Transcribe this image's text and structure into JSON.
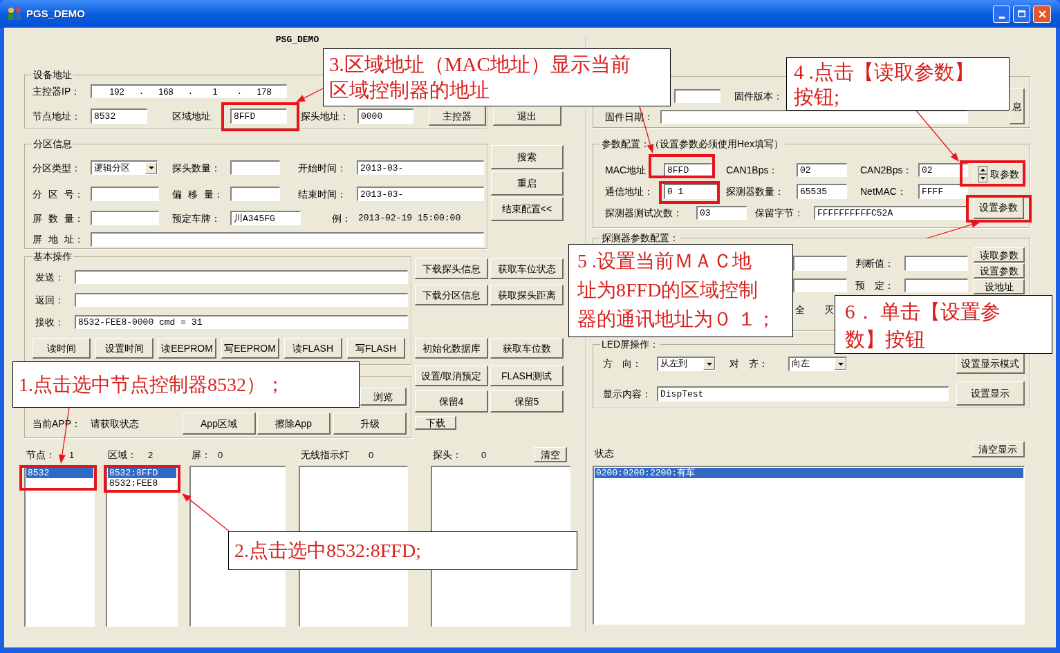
{
  "window": {
    "title": "PGS_DEMO",
    "heading": "PSG_DEMO"
  },
  "device_address": {
    "title": "设备地址",
    "ip": {
      "label": "主控器IP：",
      "octets": [
        "192",
        "168",
        "1",
        "178"
      ],
      "separators": [
        ".",
        ".",
        "."
      ]
    },
    "fields": [
      {
        "label": "节点地址：",
        "value": "8532"
      },
      {
        "label": "区域地址",
        "value": "8FFD"
      },
      {
        "label": "探头地址：",
        "value": "0000"
      }
    ],
    "buttons": [
      "主控器",
      "退出"
    ]
  },
  "partition_info": {
    "title": "分区信息",
    "rows": [
      [
        {
          "kind": "combo",
          "label": "分区类型：",
          "value": "逻辑分区"
        },
        {
          "kind": "field",
          "label": "探头数量："
        },
        {
          "kind": "field",
          "label": "开始时间：",
          "value": "2013-03-"
        }
      ],
      [
        {
          "kind": "field",
          "label": "分 区 号："
        },
        {
          "kind": "field",
          "label": "偏 移 量："
        },
        {
          "kind": "field",
          "label": "结束时间：",
          "value": "2013-03-"
        }
      ],
      [
        {
          "kind": "field",
          "label": "屏 数 量："
        },
        {
          "kind": "field",
          "label": "预定车牌：",
          "value": "川A345FG"
        },
        {
          "kind": "text",
          "label": "例：",
          "value": "2013-02-19 15:00:00"
        }
      ],
      [
        {
          "kind": "field",
          "label": "屏 地 址："
        }
      ]
    ],
    "buttons": [
      "搜索",
      "重启",
      "结束配置<<"
    ]
  },
  "basic_operations": {
    "title": "基本操作",
    "fields": [
      {
        "label": "发送："
      },
      {
        "label": "返回："
      },
      {
        "label": "接收：",
        "value": "8532-FEE8-0000 cmd = 31"
      }
    ],
    "buttons": [
      "读时间",
      "设置时间",
      "读EEPROM",
      "写EEPROM",
      "读FLASH",
      "写FLASH"
    ],
    "browse_button": "浏览",
    "app": {
      "label": "当前APP：",
      "status": "请获取状态",
      "buttons": [
        "App区域",
        "擦除App",
        "升级"
      ]
    }
  },
  "command_buttons": [
    [
      "下载探头信息",
      "获取车位状态"
    ],
    [
      "下载分区信息",
      "获取探头距离"
    ],
    [
      "初始化数据库",
      "获取车位数"
    ],
    [
      "设置/取消预定",
      "FLASH测试"
    ],
    [
      "保留4",
      "保留5"
    ],
    [
      "下载"
    ]
  ],
  "lists": [
    {
      "label": "节点：",
      "count": "1",
      "items": [
        {
          "text": "8532",
          "selected": true
        }
      ]
    },
    {
      "label": "区域：",
      "count": "2",
      "items": [
        {
          "text": "8532:8FFD",
          "selected": true
        },
        {
          "text": "8532:FEE8",
          "selected": false
        }
      ]
    },
    {
      "label": "屏：",
      "count": "0"
    },
    {
      "label": "无线指示灯",
      "count": "0"
    },
    {
      "label": "探头：",
      "count": "0",
      "button": "清空"
    }
  ],
  "firmware": {
    "version_label": "固件版本：",
    "date_label": "固件日期：",
    "button": "息"
  },
  "parameter_config": {
    "title": "参数配置：（设置参数必须使用Hex填写）",
    "rows": [
      [
        {
          "label": "MAC地址",
          "value": "8FFD"
        },
        {
          "label": "CAN1Bps：",
          "value": "02"
        },
        {
          "label": "CAN2Bps：",
          "value": "02"
        }
      ],
      [
        {
          "label": "通信地址：",
          "value": "0 1"
        },
        {
          "label": "探测器数量：",
          "value": "65535"
        },
        {
          "label": "NetMAC：",
          "value": "FFFF"
        }
      ],
      [
        {
          "label": "探测器测试次数：",
          "value": "03"
        },
        {
          "label": "保留字节：",
          "value": "FFFFFFFFFFC52A"
        }
      ]
    ],
    "buttons": [
      "取参数",
      "设置参数"
    ]
  },
  "detector_config": {
    "title": "探测器参数配置：",
    "rows": [
      {
        "label": "判断值："
      },
      {
        "label": "预　定："
      }
    ],
    "buttons": [
      "读取参数",
      "设置参数",
      "设地址"
    ],
    "options": [
      "全",
      "灭"
    ]
  },
  "led": {
    "title": "LED屏操作：",
    "direction": {
      "label": "方　向：",
      "value": "从左到"
    },
    "align": {
      "label": "对　齐：",
      "value": "向左"
    },
    "content": {
      "label": "显示内容：",
      "value": "DispTest"
    },
    "buttons": [
      "设置显示模式",
      "设置显示"
    ]
  },
  "status": {
    "label": "状态",
    "button": "清空显示",
    "items": [
      {
        "text": "0200:0200:2200:有车",
        "selected": true
      }
    ]
  },
  "annotations": [
    {
      "lines": [
        "3.区域地址（MAC地址）显示当前",
        "区域控制器的地址"
      ]
    },
    {
      "lines": [
        "4 .点击【读取参数】",
        "按钮;"
      ]
    },
    {
      "lines": [
        "5 .设置当前ＭＡＣ地",
        "址为8FFD的区域控制",
        "器的通讯地址为０ １；"
      ]
    },
    {
      "lines": [
        "6． 单击【设置参",
        "数】按钮"
      ]
    },
    {
      "lines": [
        "1.点击选中节点控制器8532）；"
      ]
    },
    {
      "lines": [
        "2.点击选中8532:8FFD;"
      ]
    }
  ]
}
